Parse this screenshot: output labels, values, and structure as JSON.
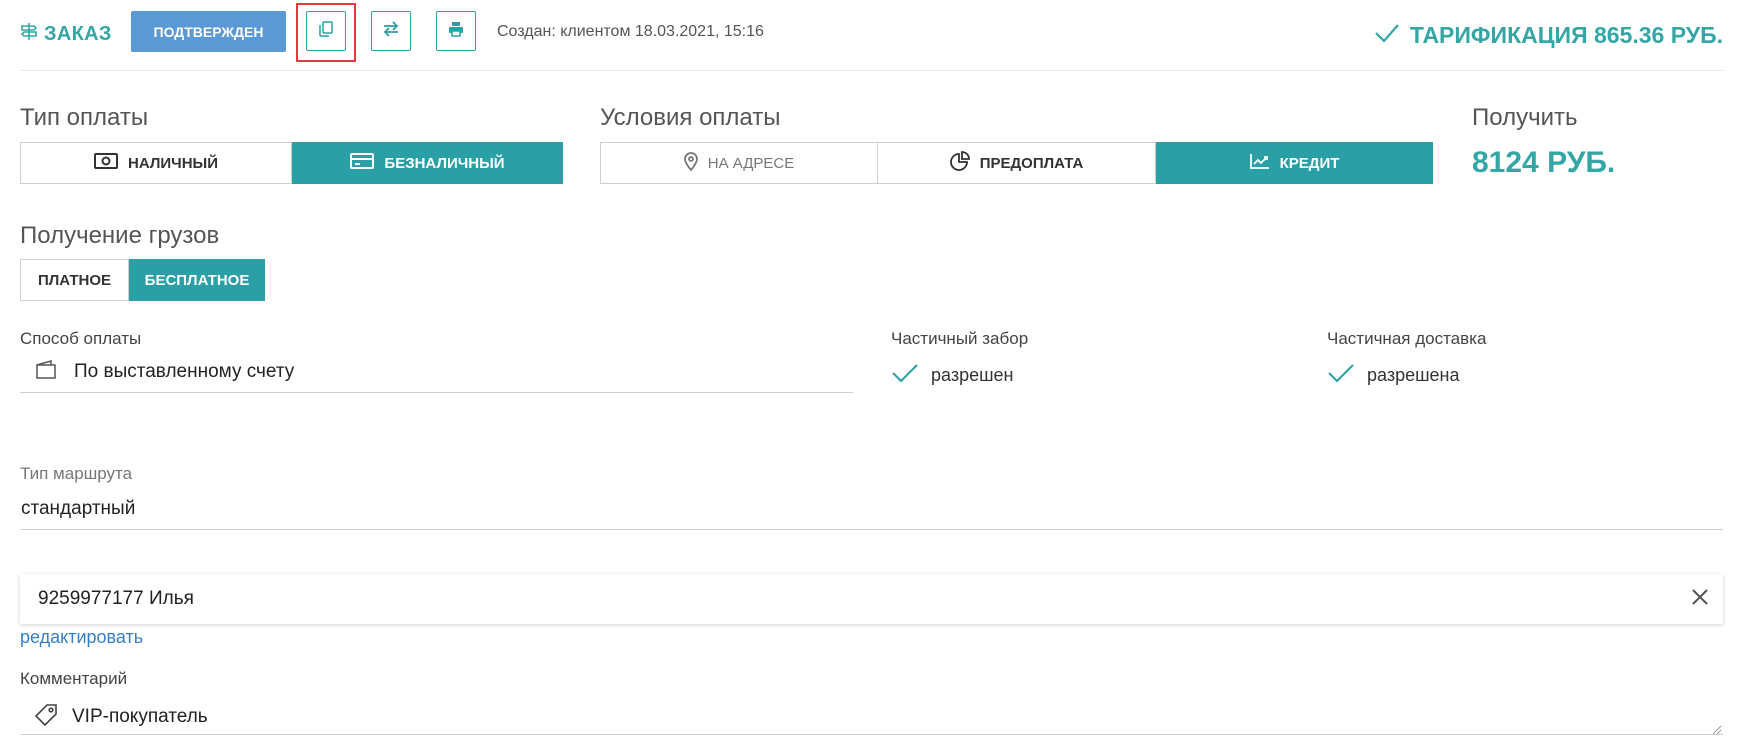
{
  "header": {
    "order_title": "ЗАКАЗ",
    "status_label": "ПОДТВЕРЖДЕН",
    "created_text": "Создан: клиентом 18.03.2021, 15:16",
    "tarif_text": "ТАРИФИКАЦИЯ 865.36 РУБ."
  },
  "payment_type": {
    "label": "Тип оплаты",
    "options": [
      "НАЛИЧНЫЙ",
      "БЕЗНАЛИЧНЫЙ"
    ],
    "active": "БЕЗНАЛИЧНЫЙ"
  },
  "payment_terms": {
    "label": "Условия оплаты",
    "options": [
      "НА АДРЕСЕ",
      "ПРЕДОПЛАТА",
      "КРЕДИТ"
    ],
    "active": "КРЕДИТ"
  },
  "receive": {
    "label": "Получить",
    "amount": "8124 РУБ."
  },
  "cargo_receipt": {
    "label": "Получение грузов",
    "options": [
      "ПЛАТНОЕ",
      "БЕСПЛАТНОЕ"
    ],
    "active": "БЕСПЛАТНОЕ"
  },
  "payment_method": {
    "label": "Способ оплаты",
    "value": "По выставленному счету"
  },
  "partial_pickup": {
    "label": "Частичный забор",
    "value": "разрешен"
  },
  "partial_delivery": {
    "label": "Частичная доставка",
    "value": "разрешена"
  },
  "route_type": {
    "label": "Тип маршрута",
    "value": "стандартный"
  },
  "contact": {
    "value": "9259977177 Илья",
    "edit_label": "редактировать"
  },
  "comment": {
    "label": "Комментарий",
    "value": "VIP-покупатель"
  },
  "colors": {
    "accent": "#2aa0a6",
    "status_blue": "#5a99d4",
    "link": "#3a7fc4",
    "highlight_red": "#e23b3b"
  }
}
